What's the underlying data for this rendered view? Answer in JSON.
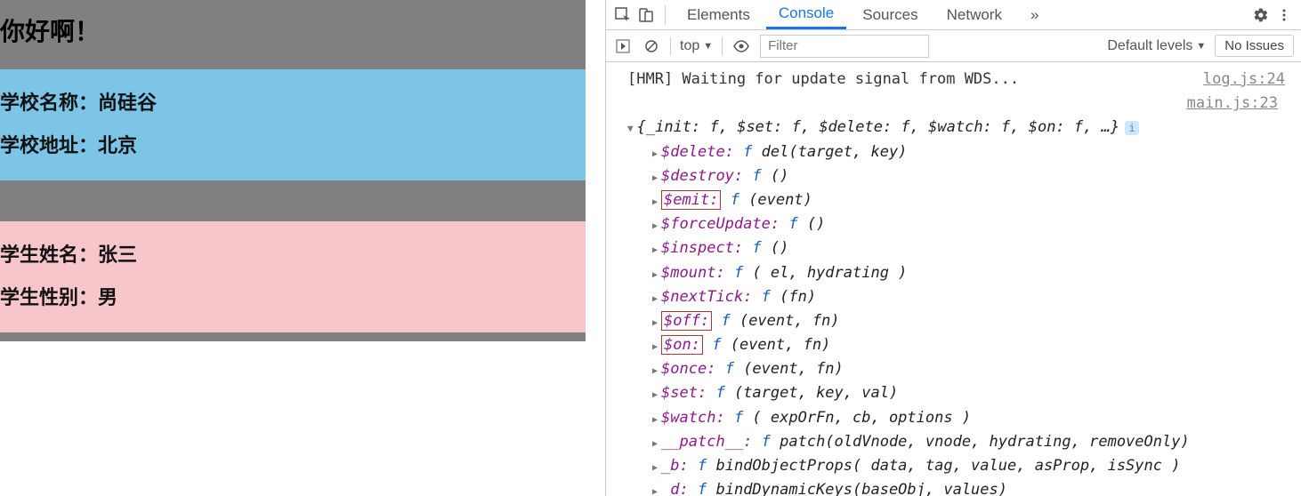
{
  "app": {
    "title": "你好啊！",
    "school": {
      "name_label": "学校名称：",
      "name_value": "尚硅谷",
      "addr_label": "学校地址：",
      "addr_value": "北京"
    },
    "student": {
      "name_label": "学生姓名：",
      "name_value": "张三",
      "gender_label": "学生性别：",
      "gender_value": "男"
    }
  },
  "devtools": {
    "tabs": {
      "elements": "Elements",
      "console": "Console",
      "sources": "Sources",
      "network": "Network",
      "more": "»"
    },
    "toolbar": {
      "context": "top",
      "filter_placeholder": "Filter",
      "levels": "Default levels",
      "noissues": "No Issues"
    },
    "console": {
      "line1_msg": "[HMR] Waiting for update signal from WDS...",
      "line1_src": "log.js:24",
      "line2_src": "main.js:23",
      "summary": "{_init: f, $set: f, $delete: f, $watch: f, $on: f, …}",
      "props": [
        {
          "key": "$delete",
          "sig": "f del(target, key)",
          "hl": false
        },
        {
          "key": "$destroy",
          "sig": "f ()",
          "hl": false
        },
        {
          "key": "$emit",
          "sig": "f (event)",
          "hl": true
        },
        {
          "key": "$forceUpdate",
          "sig": "f ()",
          "hl": false
        },
        {
          "key": "$inspect",
          "sig": "f ()",
          "hl": false
        },
        {
          "key": "$mount",
          "sig": "f ( el, hydrating )",
          "hl": false
        },
        {
          "key": "$nextTick",
          "sig": "f (fn)",
          "hl": false
        },
        {
          "key": "$off",
          "sig": "f (event, fn)",
          "hl": true
        },
        {
          "key": "$on",
          "sig": "f (event, fn)",
          "hl": true
        },
        {
          "key": "$once",
          "sig": "f (event, fn)",
          "hl": false
        },
        {
          "key": "$set",
          "sig": "f (target, key, val)",
          "hl": false
        },
        {
          "key": "$watch",
          "sig": "f ( expOrFn, cb, options )",
          "hl": false
        },
        {
          "key": "__patch__",
          "sig": "f patch(oldVnode, vnode, hydrating, removeOnly)",
          "hl": false
        },
        {
          "key": "_b",
          "sig": "f bindObjectProps( data, tag, value, asProp, isSync )",
          "hl": false
        },
        {
          "key": "_d",
          "sig": "f bindDynamicKeys(baseObj, values)",
          "hl": false
        }
      ]
    }
  }
}
